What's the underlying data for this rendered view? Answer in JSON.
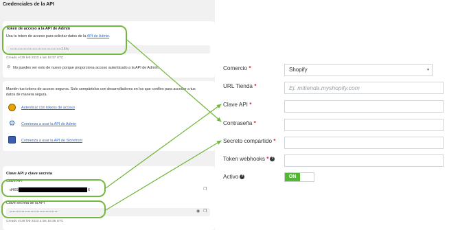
{
  "left": {
    "page_title": "Credenciales de la API",
    "admin_token": {
      "title": "Token de acceso a la API de Admin",
      "desc_prefix": "Usa tu token de acceso para solicitar datos de la ",
      "desc_link": "API de Admin",
      "desc_suffix": ".",
      "masked_value": "••••••••••••••••••••••••••••••••••25fc",
      "created": "Creado el 28 feb 2023 a las 18:37 UTC",
      "notice": "No puedes ver esto de nuevo porque proporciona acceso autenticado a la API de Admin."
    },
    "info_card": {
      "text": "Mantén tus tokens de acceso seguros. Solo compártelos con desarrolladores en los que confíes para acceder a tus datos de manera segura.",
      "links": [
        {
          "label": "Autenticar con tokens de acceso",
          "icon": "coin-icon"
        },
        {
          "label": "Comienza a usar la API de Admin",
          "icon": "gear-icon"
        },
        {
          "label": "Comienza a usar la API de Storefront",
          "icon": "storefront-icon"
        }
      ]
    },
    "api_keys": {
      "title": "Clave API y clave secreta",
      "key_label": "Clave API",
      "key_value_prefix": "d465",
      "key_value_suffix": "6",
      "secret_label": "Clave secreta de la API",
      "secret_masked": "••••••••••••••••••••••••••••••••",
      "created": "Creado el 28 feb 2023 a las 18:35 UTC"
    }
  },
  "form": {
    "fields": [
      {
        "label": "Comercio",
        "required": true,
        "value": "Shopify",
        "type": "select"
      },
      {
        "label": "URL Tienda",
        "required": true,
        "placeholder": "Ej. mitienda.myshopify.com",
        "type": "text"
      },
      {
        "label": "Clave API",
        "required": true,
        "type": "text"
      },
      {
        "label": "Contraseña",
        "required": true,
        "type": "text"
      },
      {
        "label": "Secreto compartido",
        "required": true,
        "type": "text"
      },
      {
        "label": "Token webhooks",
        "required": true,
        "help": true,
        "type": "text"
      },
      {
        "label": "Activo",
        "help": true,
        "type": "toggle",
        "value": "ON"
      }
    ],
    "required_mark": "*",
    "help_mark": "?"
  },
  "colors": {
    "highlight": "#72b83f",
    "link": "#2c6ecb",
    "toggle_on": "#52b832",
    "required": "#e1232f"
  }
}
